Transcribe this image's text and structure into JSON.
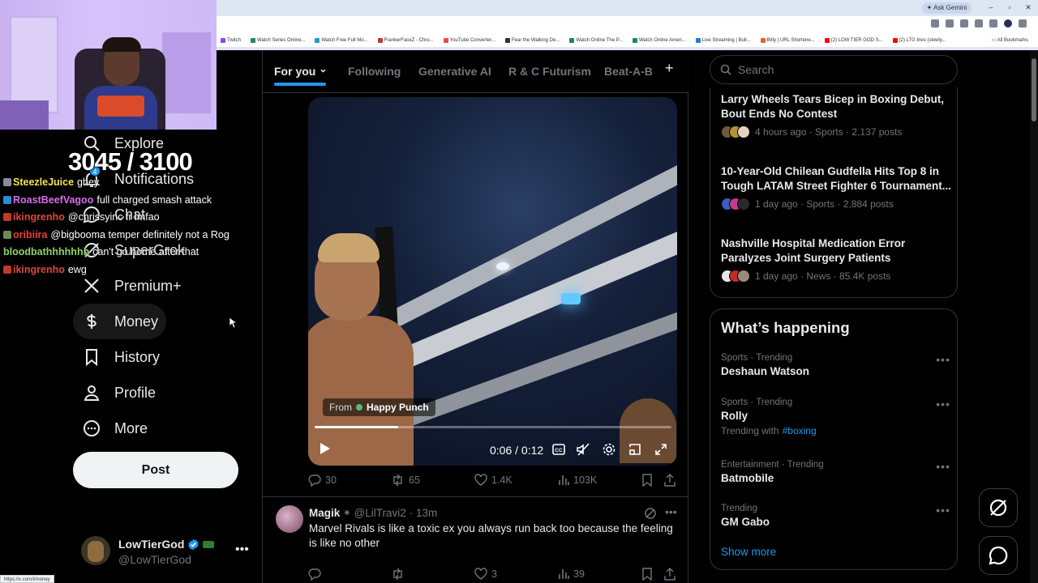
{
  "browser": {
    "ask_gemini": "Ask Gemini",
    "bookmarks": [
      {
        "label": "Twitch",
        "color": "#9146ff"
      },
      {
        "label": "Watch Series Online...",
        "color": "#1b8a5a"
      },
      {
        "label": "Watch Free Full Mo...",
        "color": "#16a0c9"
      },
      {
        "label": "FrankerFaceZ - Chro...",
        "color": "#c0392b"
      },
      {
        "label": "YouTube Converter...",
        "color": "#e74c3c"
      },
      {
        "label": "Fear the Walking De...",
        "color": "#333333"
      },
      {
        "label": "Watch Online The P...",
        "color": "#1b8a5a"
      },
      {
        "label": "Watch Online Ameri...",
        "color": "#1b8a5a"
      },
      {
        "label": "Live Streaming | Bull...",
        "color": "#2a7ad1"
      },
      {
        "label": "Bitly | URL Shortene...",
        "color": "#ee6123"
      },
      {
        "label": "(2) LOW TIER GOD S...",
        "color": "#ff0000"
      },
      {
        "label": "(2) LTG tries (slowly...",
        "color": "#ff0000"
      }
    ],
    "all_bookmarks": "All Bookmarks",
    "status_url": "https://x.com/i/money"
  },
  "stream": {
    "counter": "3045 / 3100",
    "chat": [
      {
        "user": "SteezleJuice",
        "color": "#f3e64a",
        "badge": "#8a8a9a",
        "text": "ghey"
      },
      {
        "user": "RoastBeefVagoo",
        "color": "#d86cf0",
        "badge": "#2a8bd8",
        "text": "full charged smash attack"
      },
      {
        "user": "ikingrenho",
        "color": "#e0463a",
        "badge": "#c0392b",
        "text": "@chrissyinc fr lmfao"
      },
      {
        "user": "oribiira",
        "color": "#ee3b3b",
        "badge": "#6a8a5a",
        "text": "@bigbooma temper definitely not a Rog"
      },
      {
        "user": "bloodbathhhhhhh",
        "color": "#8ed46a",
        "badge": "",
        "text": "can't go home after that"
      },
      {
        "user": "ikingrenho",
        "color": "#e0463a",
        "badge": "#c0392b",
        "text": "ewg"
      }
    ]
  },
  "nav": {
    "items": [
      {
        "label": "Explore",
        "icon": "search-icon"
      },
      {
        "label": "Notifications",
        "icon": "bell-icon",
        "badge": "4"
      },
      {
        "label": "Chat",
        "icon": "chat-icon"
      },
      {
        "label": "SuperGrok",
        "icon": "grok-icon"
      },
      {
        "label": "Premium+",
        "icon": "x-logo-icon"
      },
      {
        "label": "Money",
        "icon": "money-icon"
      },
      {
        "label": "History",
        "icon": "bookmark-icon"
      },
      {
        "label": "Profile",
        "icon": "person-icon"
      },
      {
        "label": "More",
        "icon": "more-circle-icon"
      }
    ],
    "post_label": "Post",
    "account": {
      "name": "LowTierGod",
      "handle": "@LowTierGod"
    }
  },
  "feed": {
    "tabs": [
      "For you",
      "Following",
      "Generative AI",
      "R & C Futurism",
      "Beat-A-B"
    ],
    "active_tab": 0,
    "video_post": {
      "from_label": "From",
      "from_source": "Happy Punch",
      "time": "0:06 / 0:12",
      "progress": 0.5,
      "replies": "30",
      "reposts": "65",
      "likes": "1.4K",
      "views": "103K"
    },
    "tweet2": {
      "name": "Magik",
      "handle": "@LilTravi2",
      "time": "· 13m",
      "text": "Marvel Rivals is like a toxic ex you always run back too because the feeling is like no other",
      "replies": "",
      "reposts": "",
      "likes": "3",
      "views": "39"
    }
  },
  "sidebar": {
    "search_placeholder": "Search",
    "news": [
      {
        "title": "Larry Wheels Tears Bicep in Boxing Debut, Bout Ends No Contest",
        "meta": "4 hours ago · Sports · 2,137 posts",
        "faces": [
          "#6b5b3a",
          "#b8923a",
          "#e2d3c0"
        ]
      },
      {
        "title": "10-Year-Old Chilean Gudfella Hits Top 8 in Tough LATAM Street Fighter 6 Tournament...",
        "meta": "1 day ago · Sports · 2,884 posts",
        "faces": [
          "#3a5bc4",
          "#c43a8a",
          "#2a2a2a"
        ]
      },
      {
        "title": "Nashville Hospital Medication Error Paralyzes Joint Surgery Patients",
        "meta": "1 day ago · News · 85.4K posts",
        "faces": [
          "#e8e8e8",
          "#c02a2a",
          "#9a8a7a"
        ]
      }
    ],
    "trends_heading": "What’s happening",
    "trends": [
      {
        "context": "Sports · Trending",
        "name": "Deshaun Watson",
        "with_prefix": "",
        "with_tag": ""
      },
      {
        "context": "Sports · Trending",
        "name": "Rolly",
        "with_prefix": "Trending with",
        "with_tag": "#boxing"
      },
      {
        "context": "Entertainment · Trending",
        "name": "Batmobile",
        "with_prefix": "",
        "with_tag": ""
      },
      {
        "context": "Trending",
        "name": "GM Gabo",
        "with_prefix": "",
        "with_tag": ""
      }
    ],
    "show_more": "Show more"
  },
  "colors": {
    "accent": "#1d9bf0",
    "background": "#000000",
    "border": "#2f3336",
    "muted": "#71767b"
  }
}
